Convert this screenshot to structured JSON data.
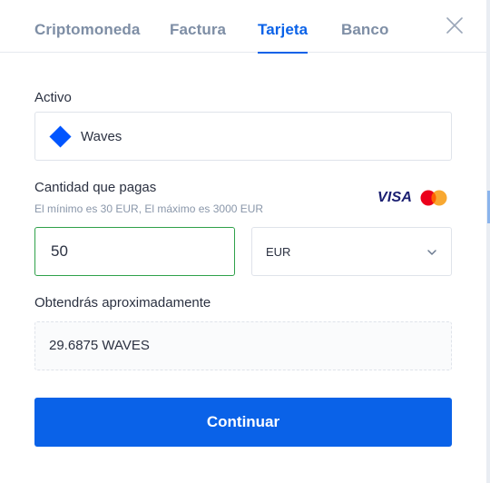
{
  "tabs": [
    {
      "label": "Criptomoneda"
    },
    {
      "label": "Factura"
    },
    {
      "label": "Tarjeta"
    },
    {
      "label": "Banco"
    }
  ],
  "active_tab": "Tarjeta",
  "asset": {
    "label": "Activo",
    "value": "Waves",
    "icon": "waves-diamond-icon",
    "icon_color": "#0055ff"
  },
  "amount": {
    "label": "Cantidad que pagas",
    "hint": "El mínimo es 30 EUR,  El máximo es 3000 EUR",
    "value": "50",
    "currency": "EUR",
    "payment_methods": [
      "VISA",
      "mastercard-icon"
    ]
  },
  "result": {
    "label": "Obtendrás aproximadamente",
    "value": "29.6875 WAVES"
  },
  "submit": {
    "label": "Continuar"
  },
  "colors": {
    "accent": "#0a62e8",
    "valid_border": "#2fa14a",
    "tab_inactive": "#7e8ea5"
  }
}
